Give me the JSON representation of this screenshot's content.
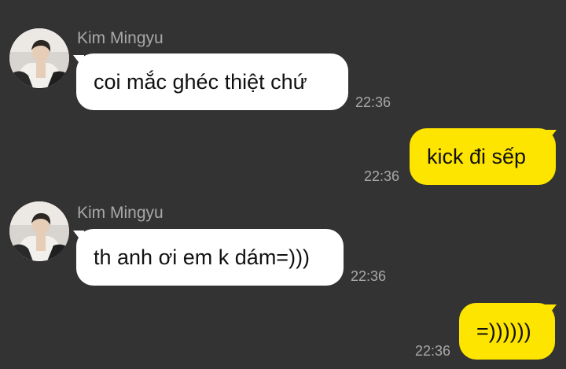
{
  "chat": {
    "messages": [
      {
        "sender": "Kim Mingyu",
        "text": "coi mắc ghéc thiệt chứ",
        "time": "22:36",
        "direction": "incoming"
      },
      {
        "text": "kick đi sếp",
        "time": "22:36",
        "direction": "outgoing"
      },
      {
        "sender": "Kim Mingyu",
        "text": "th anh ơi em k dám=)))",
        "time": "22:36",
        "direction": "incoming"
      },
      {
        "text": "=))))))",
        "time": "22:36",
        "direction": "outgoing"
      }
    ]
  },
  "colors": {
    "background": "#333333",
    "incoming_bubble": "#ffffff",
    "outgoing_bubble": "#fee500",
    "meta_text": "#a8a8a8"
  }
}
